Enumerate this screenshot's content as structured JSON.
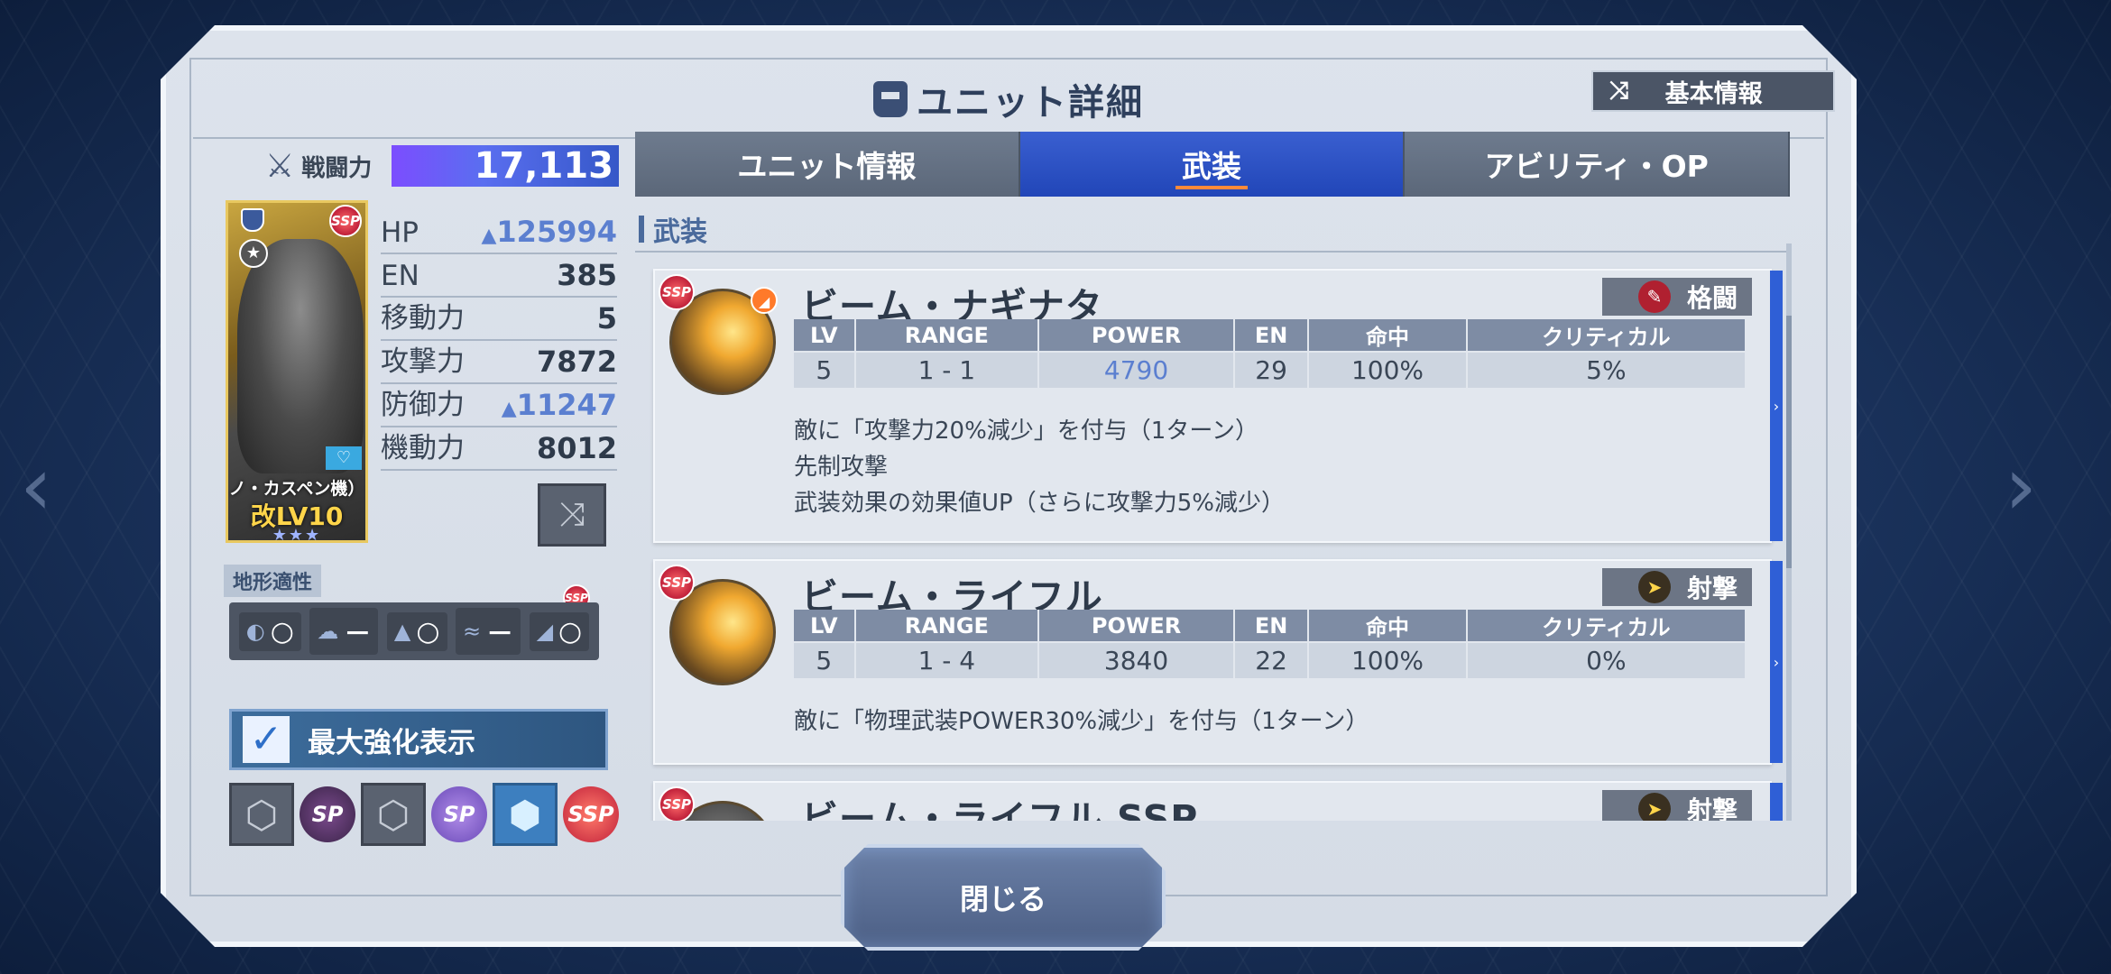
{
  "header": {
    "title": "ユニット詳細",
    "basic_info_button": "基本情報"
  },
  "power": {
    "label": "戦闘力",
    "value": "17,113"
  },
  "unit": {
    "name": "ノ・カスペン機）",
    "level": "改LV10",
    "stars": "★★★",
    "rank_badge": "SSP"
  },
  "stats": [
    {
      "label": "HP",
      "value": "125994",
      "boosted": true
    },
    {
      "label": "EN",
      "value": "385",
      "boosted": false
    },
    {
      "label": "移動力",
      "value": "5",
      "boosted": false
    },
    {
      "label": "攻撃力",
      "value": "7872",
      "boosted": false
    },
    {
      "label": "防御力",
      "value": "11247",
      "boosted": true
    },
    {
      "label": "機動力",
      "value": "8012",
      "boosted": false
    }
  ],
  "terrain": {
    "title": "地形適性",
    "items": [
      {
        "icon": "space-icon",
        "grade": "○"
      },
      {
        "icon": "air-icon",
        "grade": "－"
      },
      {
        "icon": "land-icon",
        "grade": "○"
      },
      {
        "icon": "water-icon",
        "grade": "－"
      },
      {
        "icon": "underground-icon",
        "grade": "○"
      }
    ]
  },
  "max_enhance": {
    "label": "最大強化表示",
    "checked": true
  },
  "tabs": [
    {
      "label": "ユニット情報",
      "active": false
    },
    {
      "label": "武装",
      "active": true
    },
    {
      "label": "アビリティ・OP",
      "active": false
    }
  ],
  "section": {
    "title": "武装"
  },
  "table_headers": [
    "LV",
    "RANGE",
    "POWER",
    "EN",
    "命中",
    "クリティカル"
  ],
  "weapons": [
    {
      "name": "ビーム・ナギナタ",
      "type": "格闘",
      "type_icon": "melee-icon",
      "stats": [
        "5",
        "1 - 1",
        "4790",
        "29",
        "100%",
        "5%"
      ],
      "desc": [
        "敵に「攻撃力20%減少」を付与（1ターン）",
        "先制攻撃",
        "武装効果の効果値UP（さらに攻撃力5%減少）"
      ]
    },
    {
      "name": "ビーム・ライフル",
      "type": "射撃",
      "type_icon": "shooting-icon",
      "stats": [
        "5",
        "1 - 4",
        "3840",
        "22",
        "100%",
        "0%"
      ],
      "desc": [
        "敵に「物理武装POWER30%減少」を付与（1ターン）"
      ]
    },
    {
      "name": "ビーム・ライフル SSP",
      "type": "射撃",
      "type_icon": "shooting-icon",
      "stats": [],
      "desc": []
    }
  ],
  "close_button": "閉じる",
  "colors": {
    "accent_blue": "#2146b8",
    "boost_blue": "#5b7fd0",
    "tab_indicator": "#ff8a3a"
  }
}
